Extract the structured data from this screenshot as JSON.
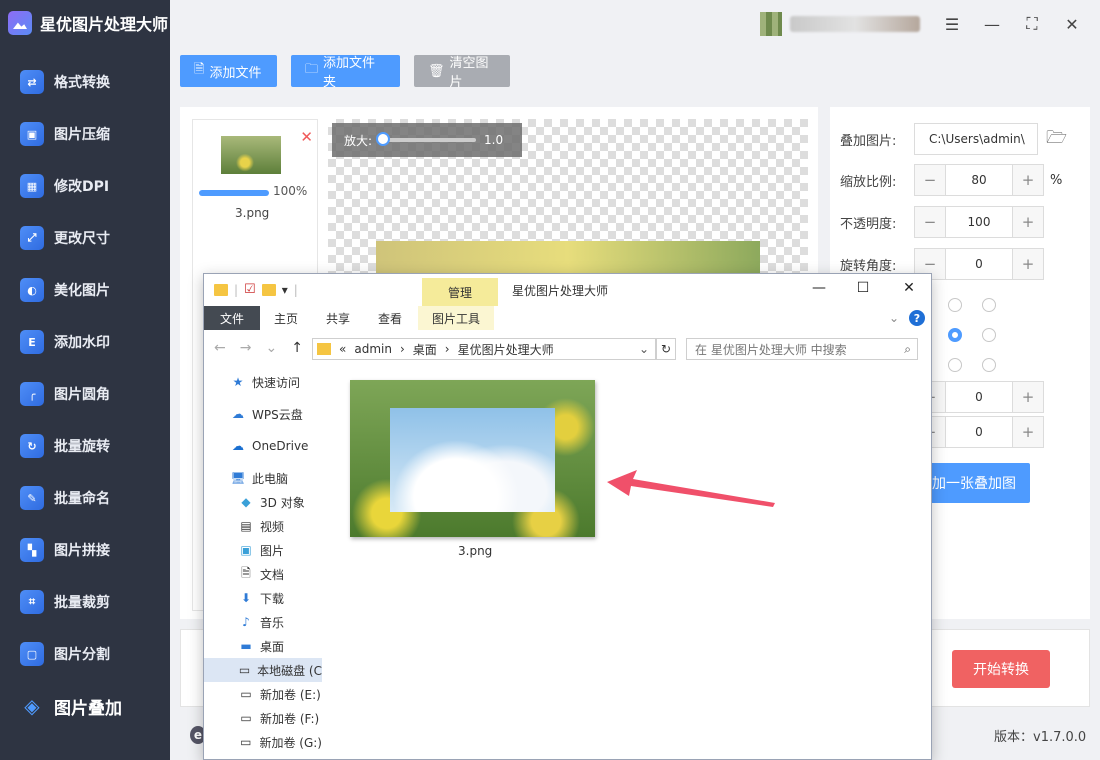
{
  "app": {
    "title": "星优图片处理大师",
    "version": "版本：v1.7.0.0"
  },
  "sidebar": {
    "items": [
      {
        "label": "格式转换",
        "icon": "image-convert-icon"
      },
      {
        "label": "图片压缩",
        "icon": "compress-icon"
      },
      {
        "label": "修改DPI",
        "icon": "dpi-icon"
      },
      {
        "label": "更改尺寸",
        "icon": "resize-icon"
      },
      {
        "label": "美化图片",
        "icon": "beautify-icon"
      },
      {
        "label": "添加水印",
        "icon": "watermark-icon"
      },
      {
        "label": "图片圆角",
        "icon": "round-corner-icon"
      },
      {
        "label": "批量旋转",
        "icon": "rotate-icon"
      },
      {
        "label": "批量命名",
        "icon": "rename-icon"
      },
      {
        "label": "图片拼接",
        "icon": "splice-icon"
      },
      {
        "label": "批量裁剪",
        "icon": "crop-icon"
      },
      {
        "label": "图片分割",
        "icon": "split-icon"
      },
      {
        "label": "图片叠加",
        "icon": "layers-icon",
        "active": true
      }
    ]
  },
  "toolbar": {
    "add_file": "添加文件",
    "add_folder": "添加文件夹",
    "clear": "清空图片"
  },
  "file_list": {
    "items": [
      {
        "name": "3.png",
        "progress": "100%",
        "progress_value": 1.0
      }
    ]
  },
  "preview": {
    "zoom_label": "放大:",
    "zoom_value": "1.0"
  },
  "settings": {
    "overlay_label": "叠加图片:",
    "overlay_path": "C:\\Users\\admin\\",
    "scale_label": "缩放比例:",
    "scale_value": "80",
    "scale_unit": "%",
    "opacity_label": "不透明度:",
    "opacity_value": "100",
    "rotate_label": "旋转角度:",
    "rotate_value": "0",
    "offset_x_value": "0",
    "offset_y_value": "0",
    "next_btn": "加一张叠加图",
    "minus": "−",
    "plus": "+"
  },
  "actions": {
    "start": "开始转换"
  },
  "explorer": {
    "manage_tab": "管理",
    "title": "星优图片处理大师",
    "ribbon": [
      "文件",
      "主页",
      "共享",
      "查看",
      "图片工具"
    ],
    "address": [
      "«",
      "admin",
      "›",
      "桌面",
      "›",
      "星优图片处理大师"
    ],
    "search_placeholder": "在 星优图片处理大师 中搜索",
    "tree": [
      {
        "label": "快速访问",
        "icon": "star-icon"
      },
      {
        "label": "WPS云盘",
        "icon": "cloud-icon"
      },
      {
        "label": "OneDrive",
        "icon": "onedrive-icon"
      },
      {
        "label": "此电脑",
        "icon": "computer-icon"
      },
      {
        "label": "3D 对象",
        "icon": "cube-icon"
      },
      {
        "label": "视频",
        "icon": "video-icon"
      },
      {
        "label": "图片",
        "icon": "pictures-icon"
      },
      {
        "label": "文档",
        "icon": "document-icon"
      },
      {
        "label": "下载",
        "icon": "download-icon"
      },
      {
        "label": "音乐",
        "icon": "music-icon"
      },
      {
        "label": "桌面",
        "icon": "desktop-icon"
      },
      {
        "label": "本地磁盘 (C",
        "icon": "drive-icon",
        "selected": true
      },
      {
        "label": "新加卷 (E:)",
        "icon": "drive-icon"
      },
      {
        "label": "新加卷 (F:)",
        "icon": "drive-icon"
      },
      {
        "label": "新加卷 (G:)",
        "icon": "drive-icon"
      }
    ],
    "files": [
      {
        "name": "3.png"
      }
    ]
  },
  "colors": {
    "accent": "#4e9bff",
    "start": "#f06262",
    "sidebar": "#2e3442"
  }
}
